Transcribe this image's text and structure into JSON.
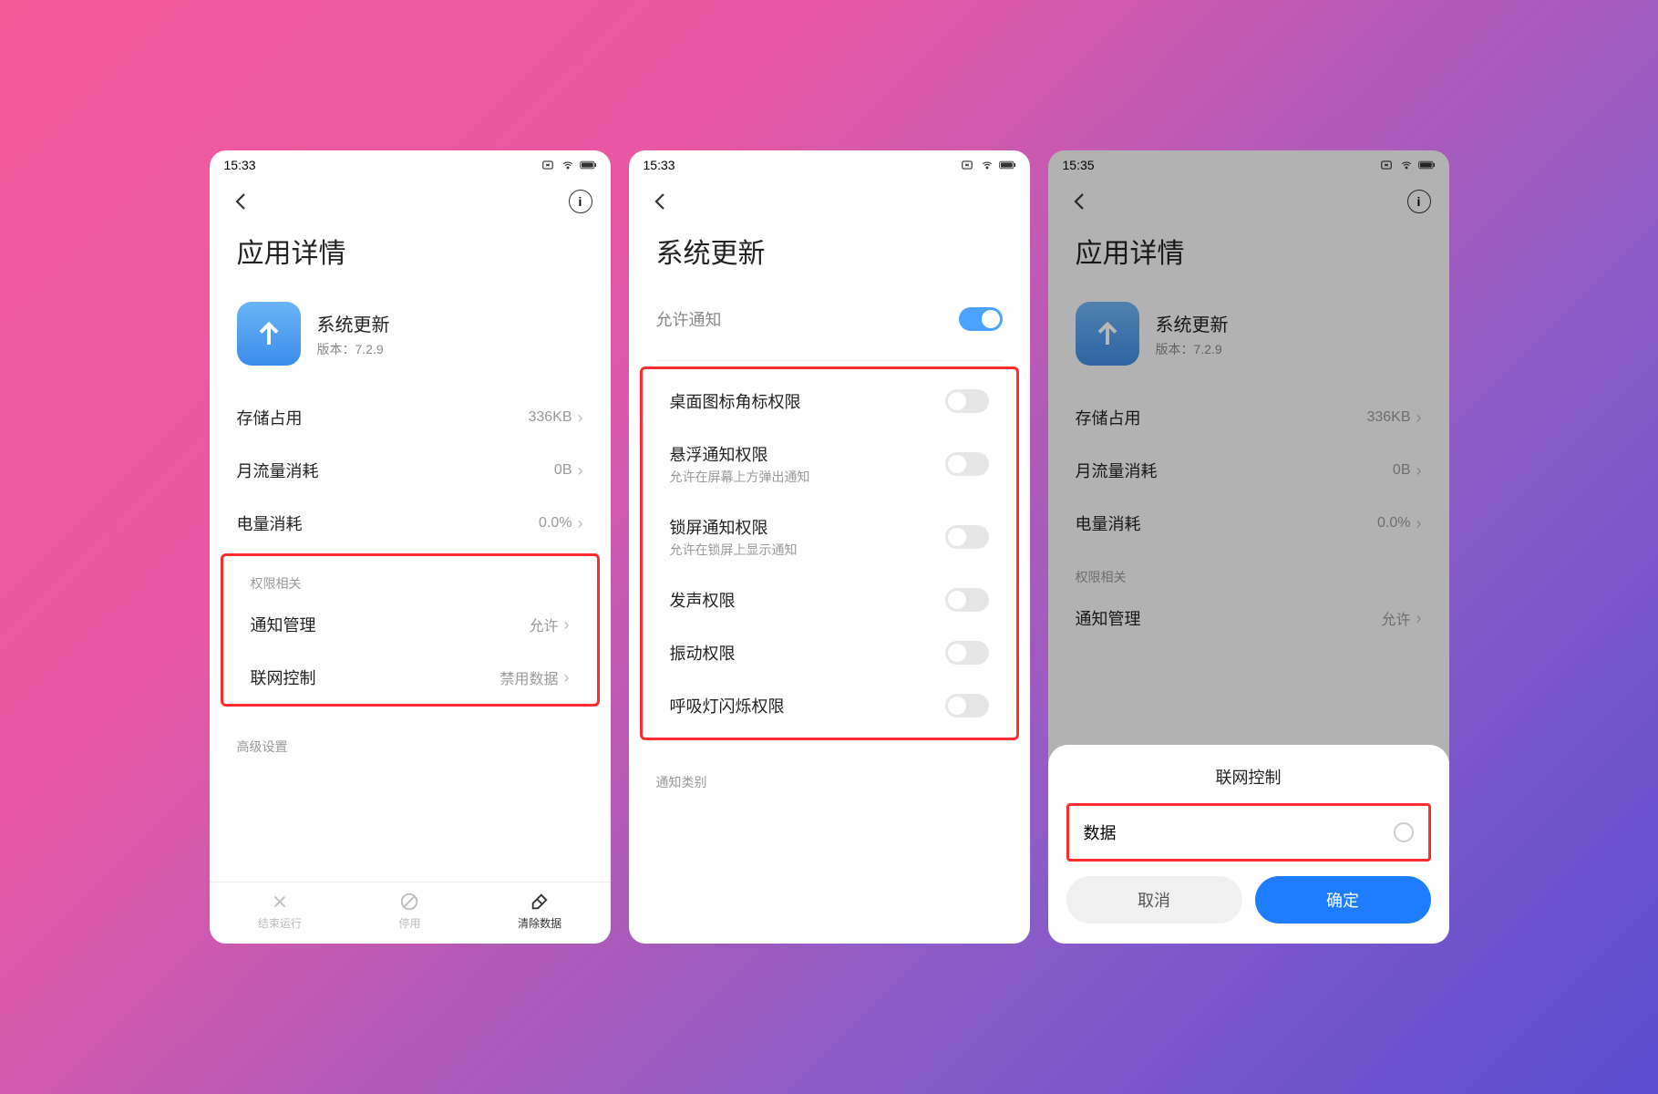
{
  "screen1": {
    "time": "15:33",
    "title": "应用详情",
    "app_name": "系统更新",
    "app_version": "版本：7.2.9",
    "storage_label": "存储占用",
    "storage_value": "336KB",
    "data_label": "月流量消耗",
    "data_value": "0B",
    "battery_label": "电量消耗",
    "battery_value": "0.0%",
    "perm_section": "权限相关",
    "notif_label": "通知管理",
    "notif_value": "允许",
    "network_label": "联网控制",
    "network_value": "禁用数据",
    "advanced_section": "高级设置",
    "action_stop": "结束运行",
    "action_disable": "停用",
    "action_clear": "清除数据"
  },
  "screen2": {
    "time": "15:33",
    "title": "系统更新",
    "allow_notif": "允许通知",
    "perms": [
      {
        "title": "桌面图标角标权限",
        "sub": ""
      },
      {
        "title": "悬浮通知权限",
        "sub": "允许在屏幕上方弹出通知"
      },
      {
        "title": "锁屏通知权限",
        "sub": "允许在锁屏上显示通知"
      },
      {
        "title": "发声权限",
        "sub": ""
      },
      {
        "title": "振动权限",
        "sub": ""
      },
      {
        "title": "呼吸灯闪烁权限",
        "sub": ""
      }
    ],
    "category_label": "通知类别"
  },
  "screen3": {
    "time": "15:35",
    "title": "应用详情",
    "app_name": "系统更新",
    "app_version": "版本：7.2.9",
    "storage_label": "存储占用",
    "storage_value": "336KB",
    "data_label": "月流量消耗",
    "data_value": "0B",
    "battery_label": "电量消耗",
    "battery_value": "0.0%",
    "perm_section": "权限相关",
    "notif_label": "通知管理",
    "notif_value": "允许",
    "sheet_title": "联网控制",
    "sheet_option": "数据",
    "cancel": "取消",
    "confirm": "确定"
  }
}
